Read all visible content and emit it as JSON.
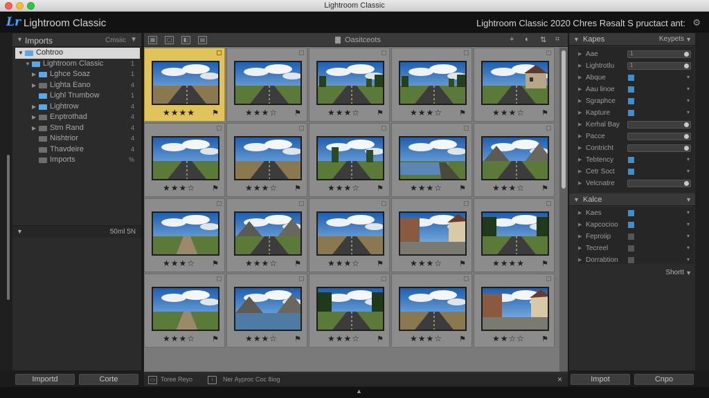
{
  "window": {
    "title": "Lightroom Classic"
  },
  "identity": {
    "logo": "Lr",
    "app_name": "Lightroom Classic",
    "right_text": "Lightroom Classic 2020  Chres Rəsalt S pructact ant:"
  },
  "left_panel": {
    "header_title": "Imports",
    "header_right": "Cmsiic",
    "tree": [
      {
        "label": "Cohtroo",
        "count": "",
        "level": 0,
        "folder": "blue",
        "selected": true,
        "arrow": "▼"
      },
      {
        "label": "Lightroom Classic",
        "count": "1",
        "level": 1,
        "folder": "blue",
        "selected": false,
        "arrow": "▼"
      },
      {
        "label": "Lghce Soaz",
        "count": "1",
        "level": 2,
        "folder": "blue",
        "selected": false,
        "arrow": "▶"
      },
      {
        "label": "Lighta Eano",
        "count": "4",
        "level": 2,
        "folder": "grey",
        "selected": false,
        "arrow": "▶"
      },
      {
        "label": "Lighl Trumbow",
        "count": "1",
        "level": 2,
        "folder": "blue",
        "selected": false,
        "arrow": ""
      },
      {
        "label": "Lightrow",
        "count": "4",
        "level": 2,
        "folder": "blue",
        "selected": false,
        "arrow": "▶"
      },
      {
        "label": "Enptrothad",
        "count": "4",
        "level": 2,
        "folder": "grey",
        "selected": false,
        "arrow": "▶"
      },
      {
        "label": "Stm Rand",
        "count": "4",
        "level": 2,
        "folder": "grey",
        "selected": false,
        "arrow": "▶"
      },
      {
        "label": "Nishtrior",
        "count": "4",
        "level": 2,
        "folder": "grey",
        "selected": false,
        "arrow": ""
      },
      {
        "label": "Thavdeire",
        "count": "4",
        "level": 2,
        "folder": "grey",
        "selected": false,
        "arrow": ""
      },
      {
        "label": "Imports",
        "count": "%",
        "level": 2,
        "folder": "grey",
        "selected": false,
        "arrow": ""
      }
    ],
    "footer_text": "50ml 5N"
  },
  "bottom_left": {
    "import_label": "Importd",
    "other_label": "Corte"
  },
  "center": {
    "toolbar_title": "Oasitceots",
    "toolbar_plus": "+",
    "bottom_text_1": "Toree Reyo",
    "bottom_text_2": "Ner Ayproc Coc 8iog",
    "bottom_close": "×"
  },
  "grid": {
    "thumbnails": [
      {
        "stars": "★★★★",
        "scene": "road-plain",
        "selected": true
      },
      {
        "stars": "★★★☆",
        "scene": "road-yellow"
      },
      {
        "stars": "★★★☆",
        "scene": "road-trees"
      },
      {
        "stars": "★★★☆",
        "scene": "road-trees2"
      },
      {
        "stars": "★★★☆",
        "scene": "house"
      },
      {
        "stars": "★★★☆",
        "scene": "road-clouds"
      },
      {
        "stars": "★★★☆",
        "scene": "road-plain"
      },
      {
        "stars": "★★★☆",
        "scene": "tree-field"
      },
      {
        "stars": "★★★☆",
        "scene": "lake-road"
      },
      {
        "stars": "★★★☆",
        "scene": "mountain-road"
      },
      {
        "stars": "★★★☆",
        "scene": "dirt-road"
      },
      {
        "stars": "★★★☆",
        "scene": "mountain-road"
      },
      {
        "stars": "★★★☆",
        "scene": "road-plain"
      },
      {
        "stars": "★★★☆",
        "scene": "town"
      },
      {
        "stars": "★★★★",
        "scene": "forest-road"
      },
      {
        "stars": "★★★☆",
        "scene": "dirt-road"
      },
      {
        "stars": "★★★☆",
        "scene": "lake-mountain"
      },
      {
        "stars": "★★★☆",
        "scene": "forest-road"
      },
      {
        "stars": "★★★☆",
        "scene": "road-plain"
      },
      {
        "stars": "★★☆☆",
        "scene": "town"
      }
    ]
  },
  "right_panel": {
    "header_title": "Kapes",
    "header_right": "Keypets",
    "rows": [
      {
        "label": "Aae",
        "type": "field",
        "value": "1"
      },
      {
        "label": "Lightrotlu",
        "type": "field",
        "value": "1"
      },
      {
        "label": "Abque",
        "type": "square"
      },
      {
        "label": "Aau linoe",
        "type": "square"
      },
      {
        "label": "Sgraphce",
        "type": "square"
      },
      {
        "label": "Kapture",
        "type": "square"
      },
      {
        "label": "Kerhal Bay",
        "type": "field",
        "value": ""
      },
      {
        "label": "Pacce",
        "type": "field",
        "value": ""
      },
      {
        "label": "Contricht",
        "type": "field",
        "value": ""
      },
      {
        "label": "Tebtency",
        "type": "square"
      },
      {
        "label": "Cetr Soct",
        "type": "square"
      },
      {
        "label": "Velcnatre",
        "type": "field",
        "value": ""
      }
    ],
    "section2_title": "Kalce",
    "rows2": [
      {
        "label": "Kaes",
        "type": "square"
      },
      {
        "label": "Kapcocioo",
        "type": "square"
      },
      {
        "label": "Feproiip",
        "type": "dark"
      },
      {
        "label": "Tecreel",
        "type": "dark"
      },
      {
        "label": "Dorrabtion",
        "type": "dark"
      }
    ],
    "footer_right": "Shortt"
  },
  "bottom_right": {
    "import_label": "Impot",
    "other_label": "Cnpo"
  }
}
